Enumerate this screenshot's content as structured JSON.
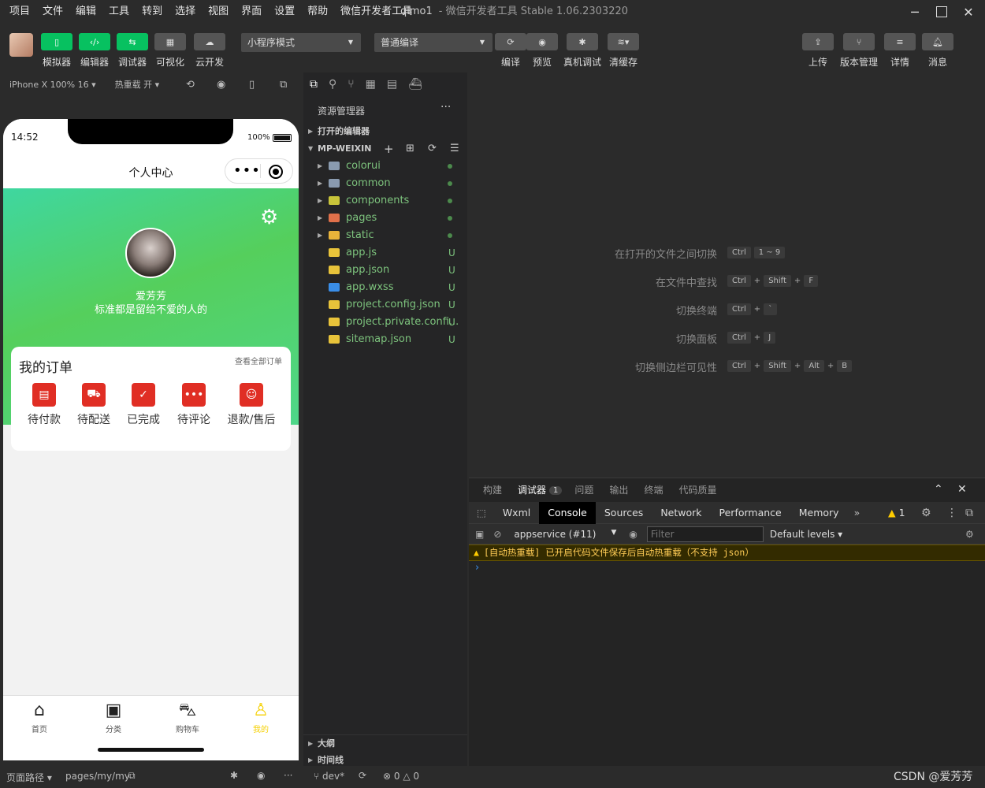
{
  "menubar": {
    "items": [
      "项目",
      "文件",
      "编辑",
      "工具",
      "转到",
      "选择",
      "视图",
      "界面",
      "设置",
      "帮助",
      "微信开发者工具"
    ],
    "project": "qimo1",
    "title": "- 微信开发者工具 Stable 1.06.2303220"
  },
  "toolbar": {
    "simulator": "模拟器",
    "editor": "编辑器",
    "debugger": "调试器",
    "visual": "可视化",
    "cloud": "云开发",
    "mode": "小程序模式",
    "compile_mode": "普通编译",
    "compile": "编译",
    "preview": "预览",
    "real_debug": "真机调试",
    "clear_cache": "清缓存",
    "upload": "上传",
    "version": "版本管理",
    "detail": "详情",
    "message": "消息"
  },
  "simhead": {
    "device": "iPhone X 100% 16",
    "hotreload": "热重载 开"
  },
  "phone": {
    "time": "14:52",
    "battery": "100%",
    "nav_title": "个人中心",
    "username": "爱芳芳",
    "signature": "标准都是留给不爱的人的",
    "orders": {
      "title": "我的订单",
      "view_all": "查看全部订单",
      "items": [
        {
          "label": "待付款",
          "icon": "wallet-icon"
        },
        {
          "label": "待配送",
          "icon": "truck-icon"
        },
        {
          "label": "已完成",
          "icon": "box-check-icon"
        },
        {
          "label": "待评论",
          "icon": "comment-icon"
        },
        {
          "label": "退款/售后",
          "icon": "service-icon"
        }
      ]
    },
    "tabs": [
      {
        "label": "首页",
        "icon": "home-icon"
      },
      {
        "label": "分类",
        "icon": "grid-icon"
      },
      {
        "label": "购物车",
        "icon": "cart-icon"
      },
      {
        "label": "我的",
        "icon": "user-icon"
      }
    ],
    "active_tab_color": "#f5d000"
  },
  "footer": {
    "path_label": "页面路径",
    "path": "pages/my/my",
    "branch": "dev*",
    "errors": "0",
    "warnings": "0",
    "watermark": "CSDN @爱芳芳"
  },
  "explorer": {
    "title": "资源管理器",
    "open_editors": "打开的编辑器",
    "project": "MP-WEIXIN",
    "files": [
      {
        "name": "colorui",
        "type": "folder",
        "status": "",
        "icon_color": "#8a9bb0"
      },
      {
        "name": "common",
        "type": "folder",
        "status": "",
        "icon_color": "#8a9bb0"
      },
      {
        "name": "components",
        "type": "folder",
        "status": "",
        "icon_color": "#c8c43a"
      },
      {
        "name": "pages",
        "type": "folder",
        "status": "",
        "icon_color": "#e0704a"
      },
      {
        "name": "static",
        "type": "folder",
        "status": "",
        "icon_color": "#e8b33a"
      },
      {
        "name": "app.js",
        "type": "file",
        "status": "U",
        "icon_color": "#e8c33a"
      },
      {
        "name": "app.json",
        "type": "file",
        "status": "U",
        "icon_color": "#e8c33a"
      },
      {
        "name": "app.wxss",
        "type": "file",
        "status": "U",
        "icon_color": "#3a8ee8"
      },
      {
        "name": "project.config.json",
        "type": "file",
        "status": "U",
        "icon_color": "#e8c33a"
      },
      {
        "name": "project.private.confi...",
        "type": "file",
        "status": "U",
        "icon_color": "#e8c33a"
      },
      {
        "name": "sitemap.json",
        "type": "file",
        "status": "U",
        "icon_color": "#e8c33a"
      }
    ],
    "outline": "大纲",
    "timeline": "时间线"
  },
  "editor_hints": [
    {
      "label": "在打开的文件之间切换",
      "keys": [
        "Ctrl",
        "1 ~ 9"
      ]
    },
    {
      "label": "在文件中查找",
      "keys": [
        "Ctrl",
        "+",
        "Shift",
        "+",
        "F"
      ]
    },
    {
      "label": "切换终端",
      "keys": [
        "Ctrl",
        "+",
        "`"
      ]
    },
    {
      "label": "切换面板",
      "keys": [
        "Ctrl",
        "+",
        "J"
      ]
    },
    {
      "label": "切换侧边栏可见性",
      "keys": [
        "Ctrl",
        "+",
        "Shift",
        "+",
        "Alt",
        "+",
        "B"
      ]
    }
  ],
  "devtools": {
    "tabs": [
      "构建",
      "调试器",
      "问题",
      "输出",
      "终端",
      "代码质量"
    ],
    "debugger_badge": "1",
    "console_tabs": [
      "Wxml",
      "Console",
      "Sources",
      "Network",
      "Performance",
      "Memory"
    ],
    "warn_count": "1",
    "context": "appservice (#11)",
    "filter_placeholder": "Filter",
    "levels": "Default levels",
    "warning": "[自动热重载] 已开启代码文件保存后自动热重载（不支持 json）"
  }
}
